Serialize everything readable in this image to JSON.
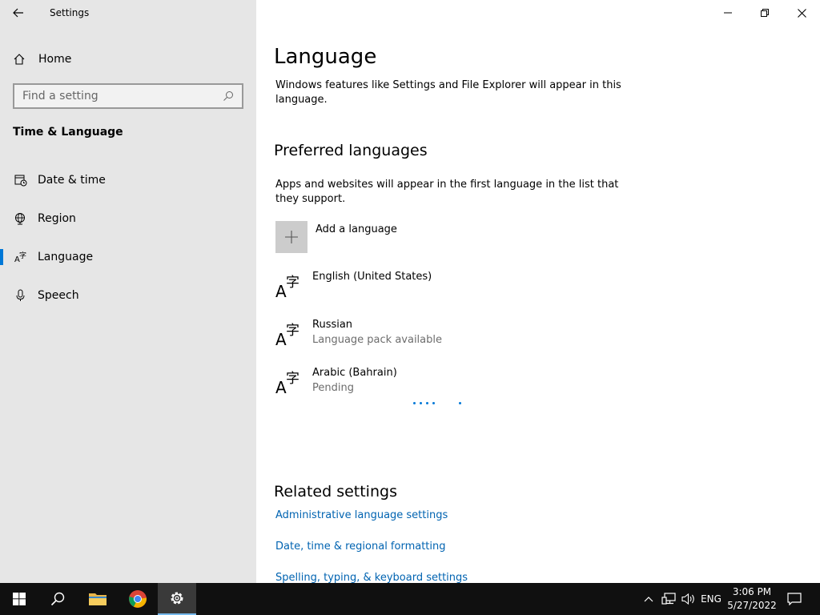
{
  "window": {
    "title": "Settings"
  },
  "sidebar": {
    "home_label": "Home",
    "search_placeholder": "Find a setting",
    "section_title": "Time & Language",
    "items": [
      {
        "label": "Date & time",
        "icon": "calendar-clock-icon"
      },
      {
        "label": "Region",
        "icon": "globe-icon"
      },
      {
        "label": "Language",
        "icon": "language-icon",
        "active": true
      },
      {
        "label": "Speech",
        "icon": "microphone-icon"
      }
    ]
  },
  "main": {
    "title": "Language",
    "title_desc": "Windows features like Settings and File Explorer will appear in this language.",
    "preferred_heading": "Preferred languages",
    "preferred_desc": "Apps and websites will appear in the first language in the list that they support.",
    "add_language_label": "Add a language",
    "languages": [
      {
        "name": "English (United States)",
        "status": ""
      },
      {
        "name": "Russian",
        "status": "Language pack available"
      },
      {
        "name": "Arabic (Bahrain)",
        "status": "Pending"
      }
    ],
    "related_heading": "Related settings",
    "related_links": [
      "Administrative language settings",
      "Date, time & regional formatting",
      "Spelling, typing, & keyboard settings"
    ]
  },
  "taskbar": {
    "language_indicator": "ENG",
    "time": "3:06 PM",
    "date": "5/27/2022"
  },
  "colors": {
    "accent": "#0078d7",
    "link": "#0063b1",
    "sidebar_bg": "#e6e6e6",
    "taskbar_bg": "#101010"
  }
}
